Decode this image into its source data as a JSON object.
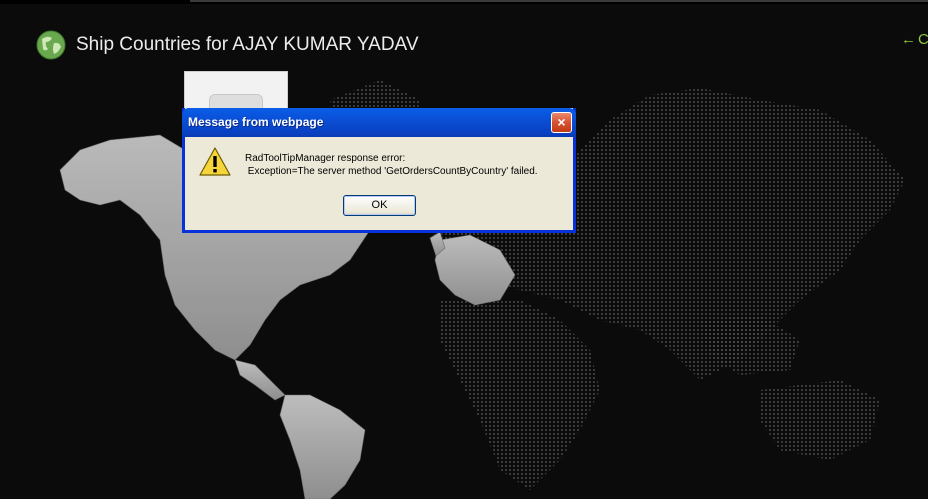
{
  "page": {
    "title": "Ship Countries for AJAY KUMAR YADAV",
    "back_link_text": "C",
    "accent_color": "#8dc63f",
    "background_color": "#0b0b0b",
    "icons": {
      "logo": "globe-icon",
      "back": "arrow-left-icon"
    }
  },
  "dialog": {
    "title": "Message from webpage",
    "message": "RadToolTipManager response error:\n Exception=The server method 'GetOrdersCountByCountry' failed.",
    "ok_label": "OK",
    "close_label": "×",
    "icons": {
      "warning": "warning-icon",
      "close": "close-icon"
    }
  }
}
